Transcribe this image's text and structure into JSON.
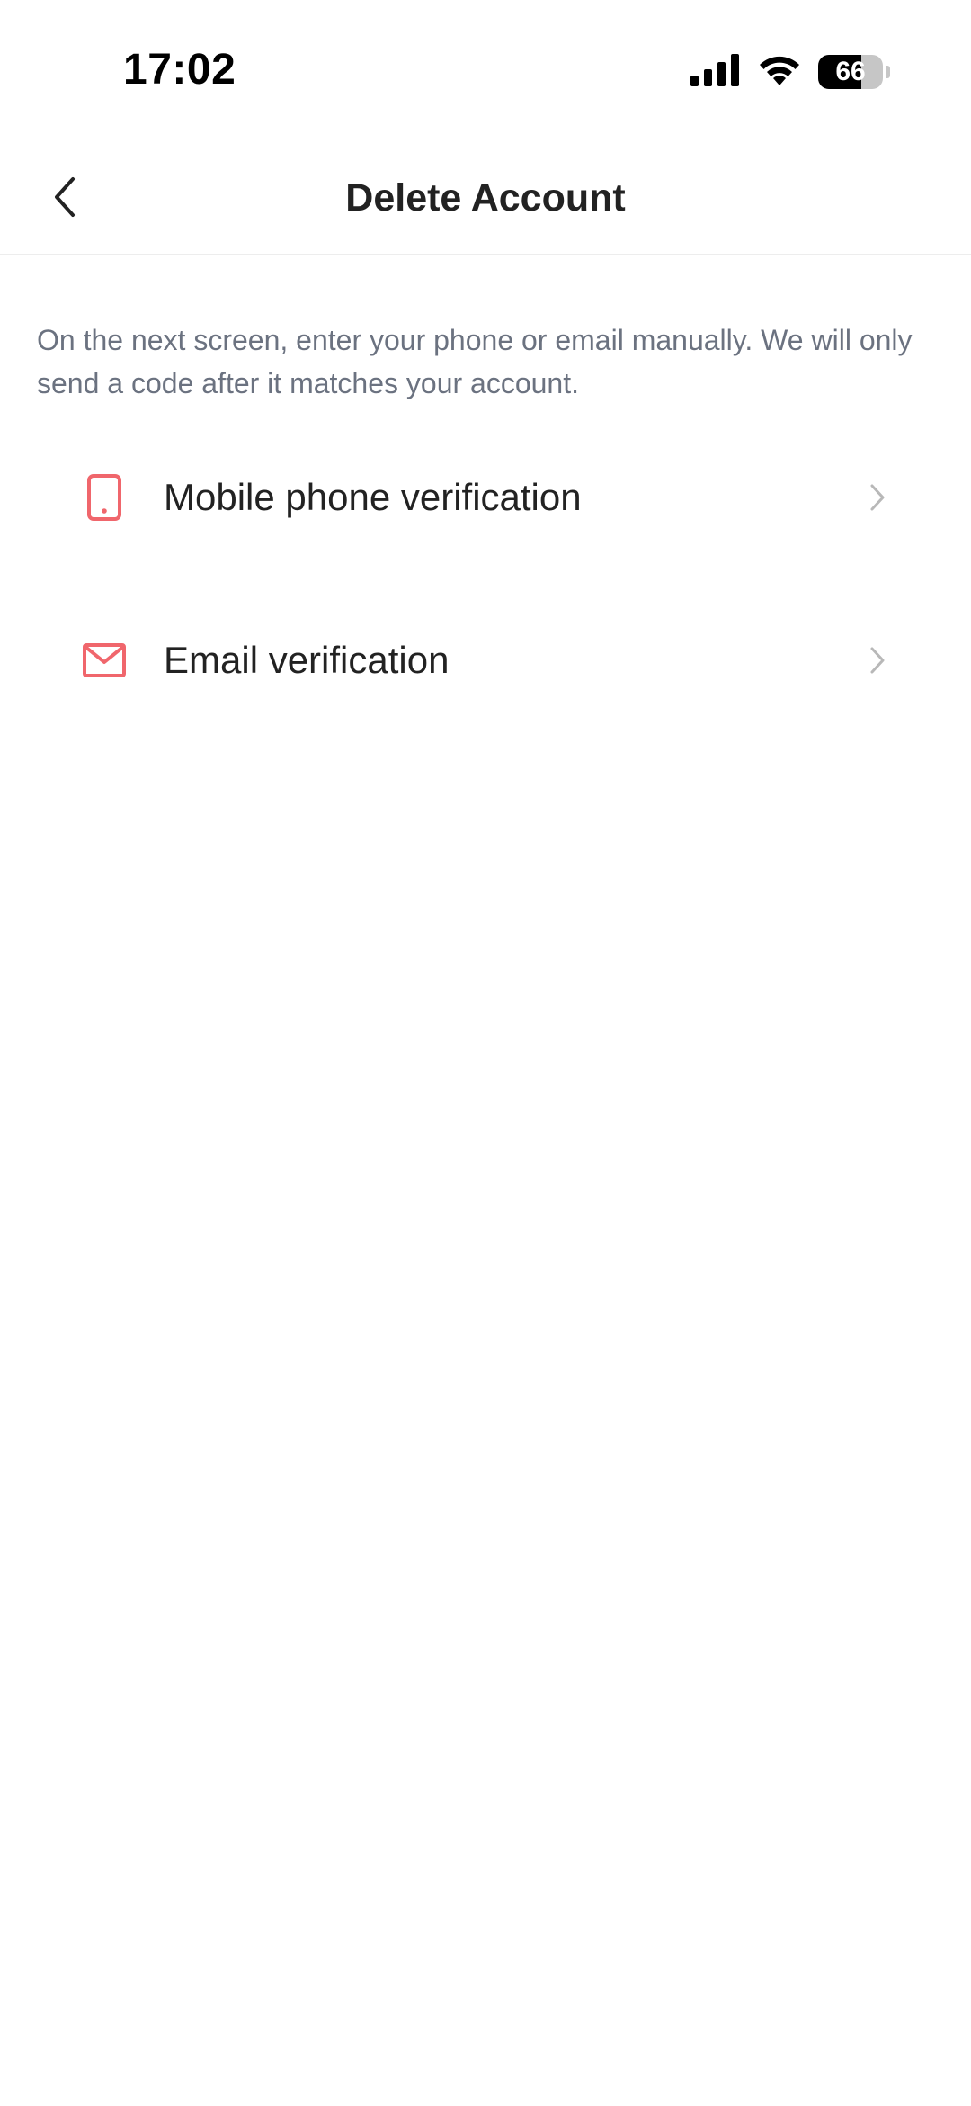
{
  "status_bar": {
    "time": "17:02",
    "battery_level": "66",
    "battery_fraction": 0.66,
    "icons": [
      "signal-icon",
      "wifi-icon",
      "battery-icon"
    ]
  },
  "header": {
    "title": "Delete Account",
    "back_icon": "chevron-left-icon"
  },
  "description": "On the next screen, enter your phone or email manually. We will only send a code after it matches your account.",
  "options": [
    {
      "label": "Mobile phone verification",
      "icon": "mobile-phone-icon"
    },
    {
      "label": "Email verification",
      "icon": "envelope-icon"
    }
  ],
  "colors": {
    "accent": "#f0666c",
    "text_primary": "#222222",
    "text_secondary": "#6b7280",
    "chevron": "#b8b8b8",
    "divider": "#ededed"
  }
}
